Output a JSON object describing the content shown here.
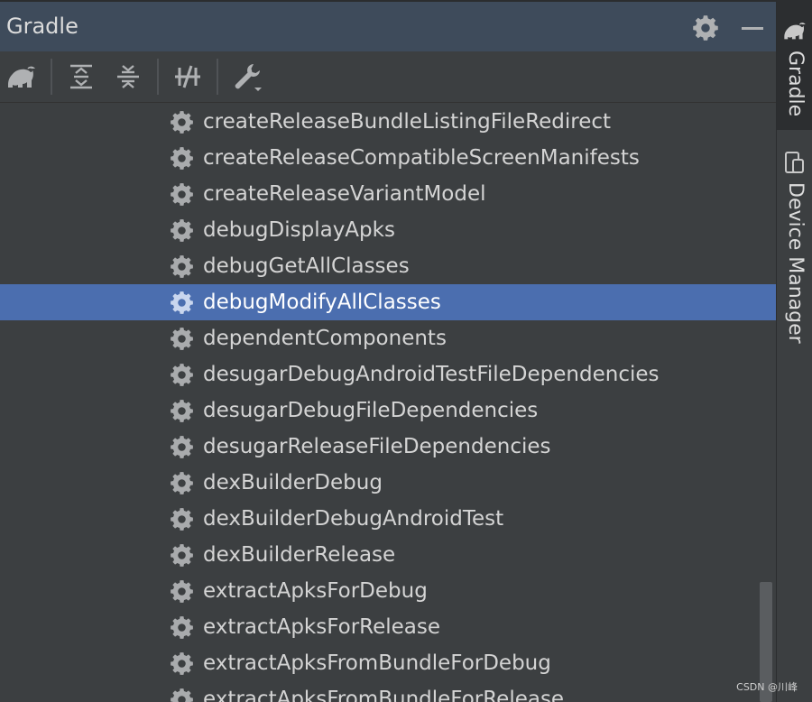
{
  "header": {
    "title": "Gradle",
    "settings_icon": "gear-icon",
    "minimize_icon": "minimize-icon"
  },
  "toolbar": {
    "buttons": [
      {
        "name": "gradle-elephant-icon"
      },
      {
        "name": "expand-all-icon"
      },
      {
        "name": "collapse-all-icon"
      },
      {
        "name": "toggle-offline-mode-icon"
      },
      {
        "name": "build-tool-settings-icon"
      }
    ]
  },
  "tree": {
    "selected_index": 5,
    "items": [
      {
        "label": "createReleaseBundleListingFileRedirect"
      },
      {
        "label": "createReleaseCompatibleScreenManifests"
      },
      {
        "label": "createReleaseVariantModel"
      },
      {
        "label": "debugDisplayApks"
      },
      {
        "label": "debugGetAllClasses"
      },
      {
        "label": "debugModifyAllClasses"
      },
      {
        "label": "dependentComponents"
      },
      {
        "label": "desugarDebugAndroidTestFileDependencies"
      },
      {
        "label": "desugarDebugFileDependencies"
      },
      {
        "label": "desugarReleaseFileDependencies"
      },
      {
        "label": "dexBuilderDebug"
      },
      {
        "label": "dexBuilderDebugAndroidTest"
      },
      {
        "label": "dexBuilderRelease"
      },
      {
        "label": "extractApksForDebug"
      },
      {
        "label": "extractApksForRelease"
      },
      {
        "label": "extractApksFromBundleForDebug"
      },
      {
        "label": "extractApksFromBundleForRelease"
      }
    ]
  },
  "sidebar": {
    "tabs": [
      {
        "label": "Gradle",
        "icon": "gradle-elephant-icon",
        "active": true
      },
      {
        "label": "Device Manager",
        "icon": "device-manager-icon",
        "active": false
      }
    ]
  },
  "watermark": "CSDN @川峰",
  "colors": {
    "header_bg": "#3e4b5b",
    "panel_bg": "#3c3f41",
    "selection": "#4b6eaf",
    "text": "#d4d4d4"
  }
}
